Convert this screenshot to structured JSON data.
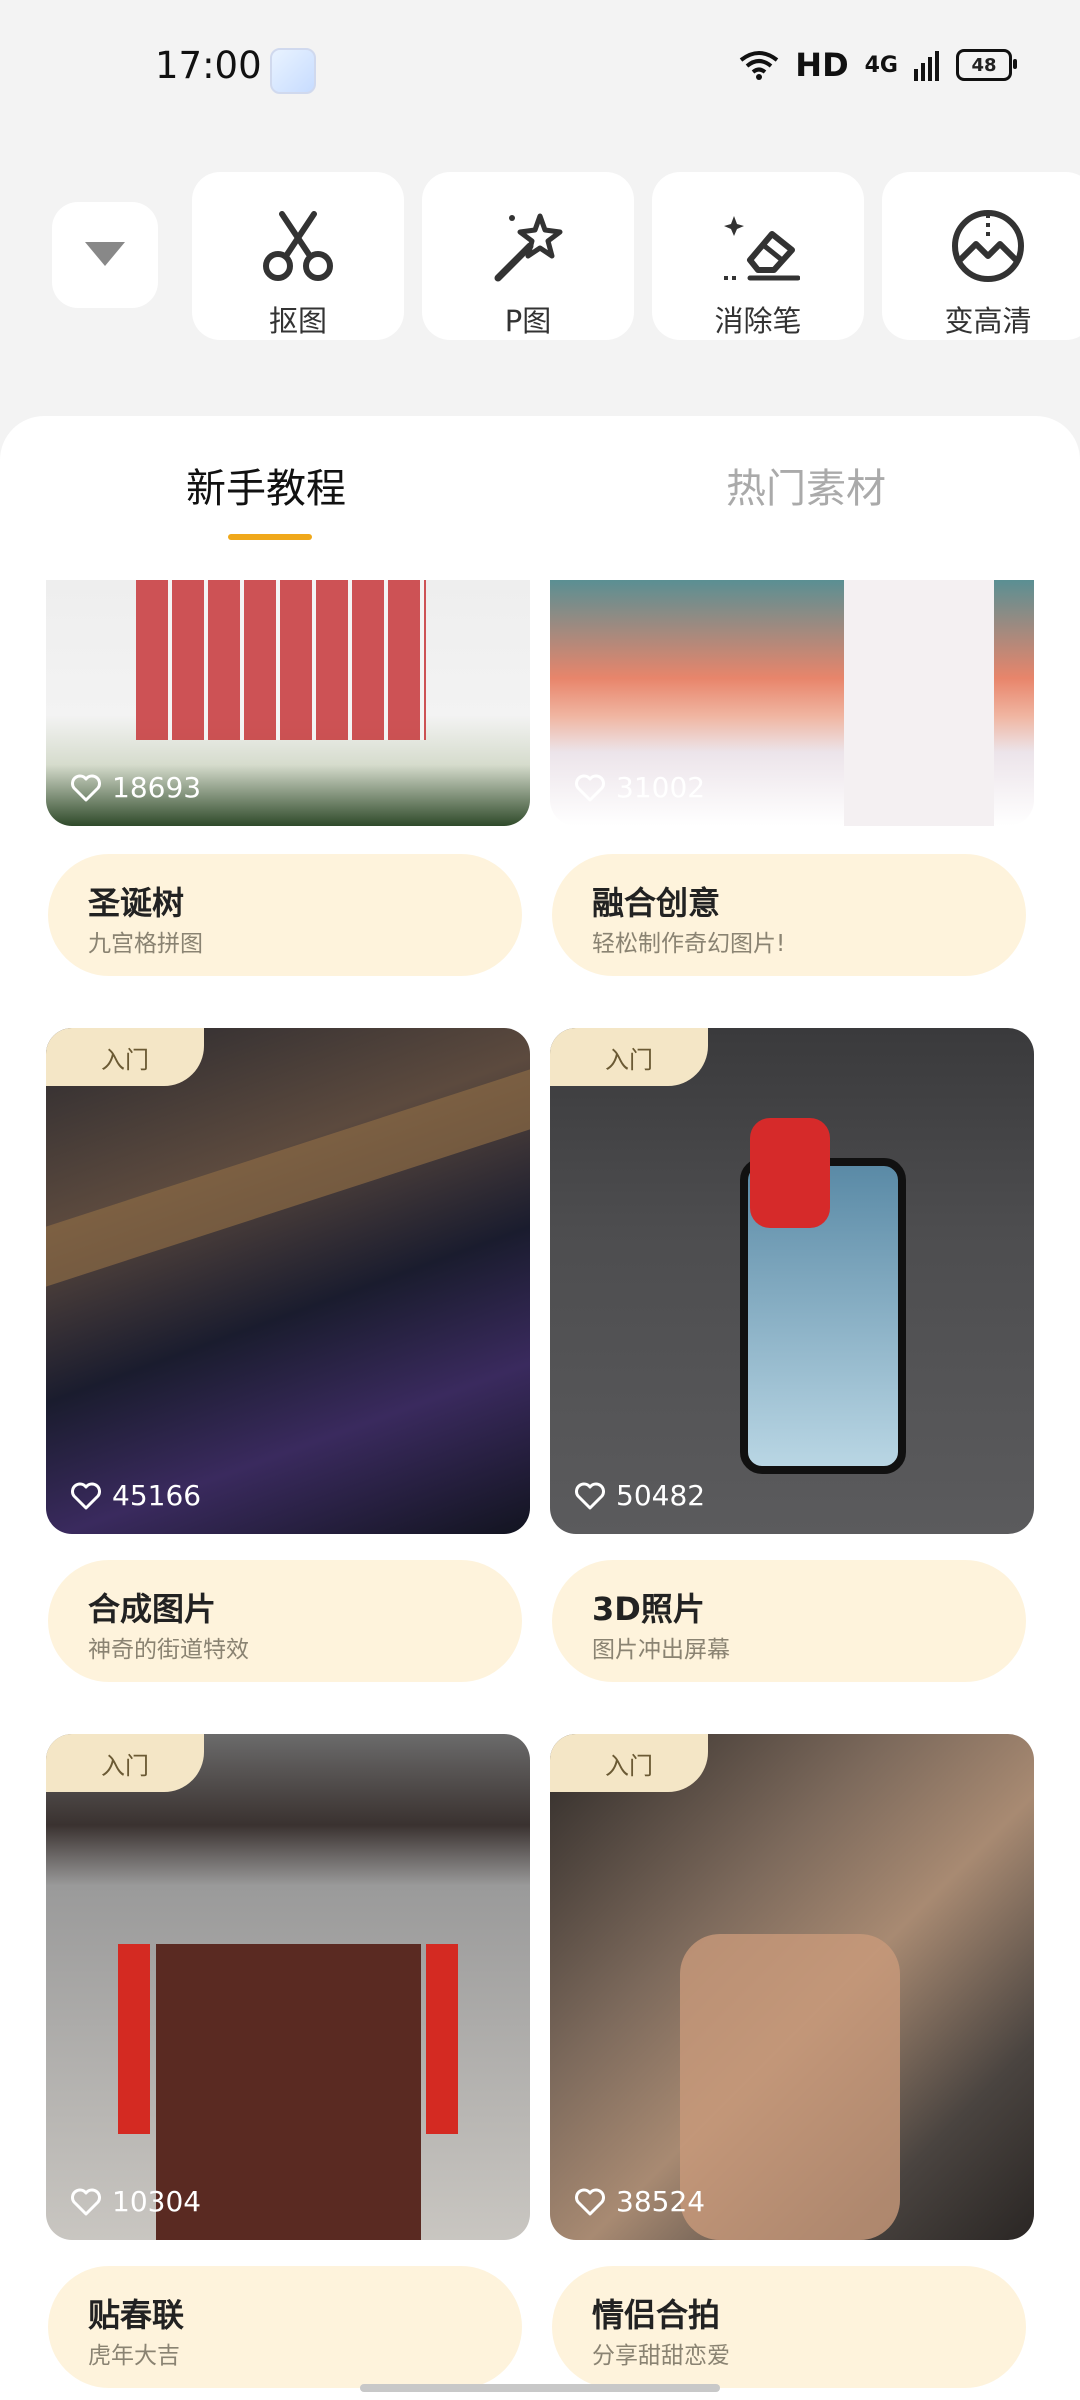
{
  "status_bar": {
    "time": "17:00",
    "hd": "HD",
    "network": "4G",
    "battery": "48"
  },
  "tools": {
    "dropdown_icon": "triangle-down-icon",
    "items": [
      {
        "label": "抠图",
        "icon": "scissors-icon"
      },
      {
        "label": "P图",
        "icon": "magic-wand-icon"
      },
      {
        "label": "消除笔",
        "icon": "eraser-icon"
      },
      {
        "label": "变高清",
        "icon": "enhance-icon"
      }
    ]
  },
  "tabs": [
    {
      "label": "新手教程",
      "active": true
    },
    {
      "label": "热门素材",
      "active": false
    }
  ],
  "accent_color": "#f0a81a",
  "cards": [
    {
      "title": "圣诞树",
      "subtitle": "九宫格拼图",
      "likes": "18693",
      "badge": ""
    },
    {
      "title": "融合创意",
      "subtitle": "轻松制作奇幻图片!",
      "likes": "31002",
      "badge": ""
    },
    {
      "title": "合成图片",
      "subtitle": "神奇的街道特效",
      "likes": "45166",
      "badge": "入门"
    },
    {
      "title": "3D照片",
      "subtitle": "图片冲出屏幕",
      "likes": "50482",
      "badge": "入门"
    },
    {
      "title": "贴春联",
      "subtitle": "虎年大吉",
      "likes": "10304",
      "badge": "入门"
    },
    {
      "title": "情侣合拍",
      "subtitle": "分享甜甜恋爱",
      "likes": "38524",
      "badge": "入门"
    }
  ]
}
